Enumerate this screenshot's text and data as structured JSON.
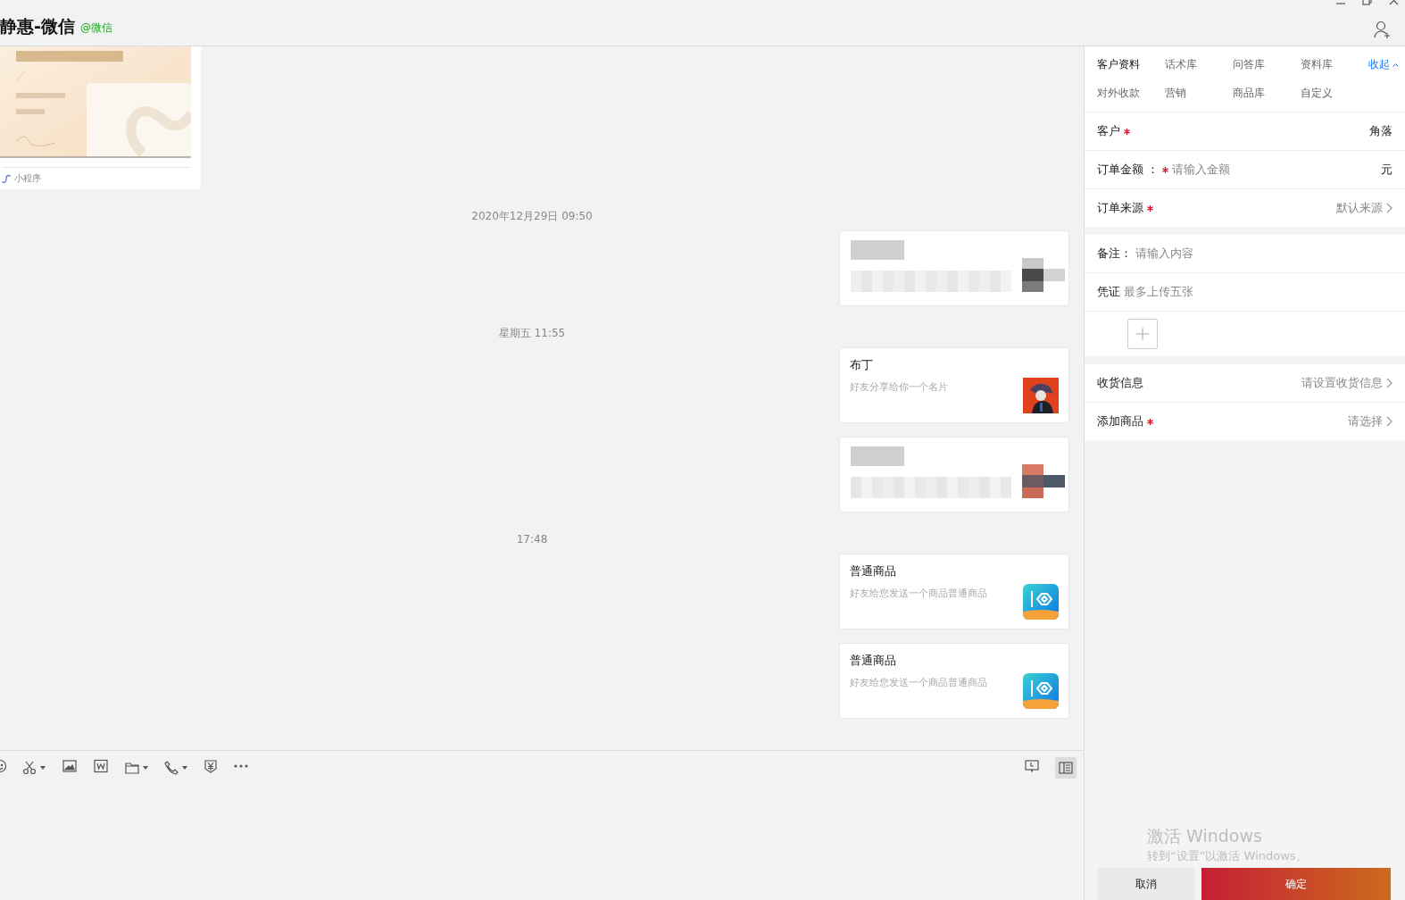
{
  "window": {
    "title": "静惠-微信",
    "account_tag": "@微信"
  },
  "chat": {
    "messages": [
      {
        "kind": "mini_program",
        "label": "小程序"
      },
      {
        "kind": "time",
        "text": "2020年12月29日 09:50"
      },
      {
        "kind": "blurred_card"
      },
      {
        "kind": "time",
        "text": "星期五 11:55"
      },
      {
        "kind": "contact_card",
        "title": "布丁",
        "subtitle": "好友分享给你一个名片"
      },
      {
        "kind": "blurred_card"
      },
      {
        "kind": "time",
        "text": "17:48"
      },
      {
        "kind": "product_card",
        "title": "普通商品",
        "subtitle": "好友给您发送一个商品普通商品"
      },
      {
        "kind": "product_card",
        "title": "普通商品",
        "subtitle": "好友给您发送一个商品普通商品"
      }
    ]
  },
  "toolbar": {
    "sidebar_toggle": {
      "selected": true
    }
  },
  "panel": {
    "tabs": [
      {
        "label": "客户资料",
        "selected": true
      },
      {
        "label": "话术库",
        "selected": false
      },
      {
        "label": "问答库",
        "selected": false
      },
      {
        "label": "资料库",
        "selected": false
      },
      {
        "label": "对外收款",
        "selected": false
      },
      {
        "label": "营销",
        "selected": false
      },
      {
        "label": "商品库",
        "selected": false
      },
      {
        "label": "自定义",
        "selected": false
      }
    ],
    "collapse_link": "收起",
    "groups": [
      {
        "rows": [
          {
            "kind": "value",
            "label": "客户",
            "required": true,
            "value": "角落"
          },
          {
            "kind": "input",
            "label": "订单金额 ：",
            "required": true,
            "placeholder": "请输入金额",
            "unit": "元"
          },
          {
            "kind": "select",
            "label": "订单来源",
            "required": true,
            "value": "默认来源"
          }
        ]
      },
      {
        "rows": [
          {
            "kind": "input",
            "label": "备注：",
            "required": false,
            "placeholder": "请输入内容"
          },
          {
            "kind": "upload",
            "label": "凭证",
            "required": false,
            "hint": "最多上传五张"
          }
        ]
      },
      {
        "rows": [
          {
            "kind": "select",
            "label": "收货信息",
            "required": false,
            "placeholder": "请设置收货信息"
          },
          {
            "kind": "select",
            "label": "添加商品",
            "required": true,
            "placeholder": "请选择"
          }
        ]
      }
    ],
    "activation_notice": {
      "title": "激活 Windows",
      "text": "转到“设置”以激活 Windows。"
    },
    "buttons": [
      {
        "kind": "cancel",
        "label": "取消"
      },
      {
        "kind": "confirm",
        "label": "确定"
      }
    ]
  }
}
